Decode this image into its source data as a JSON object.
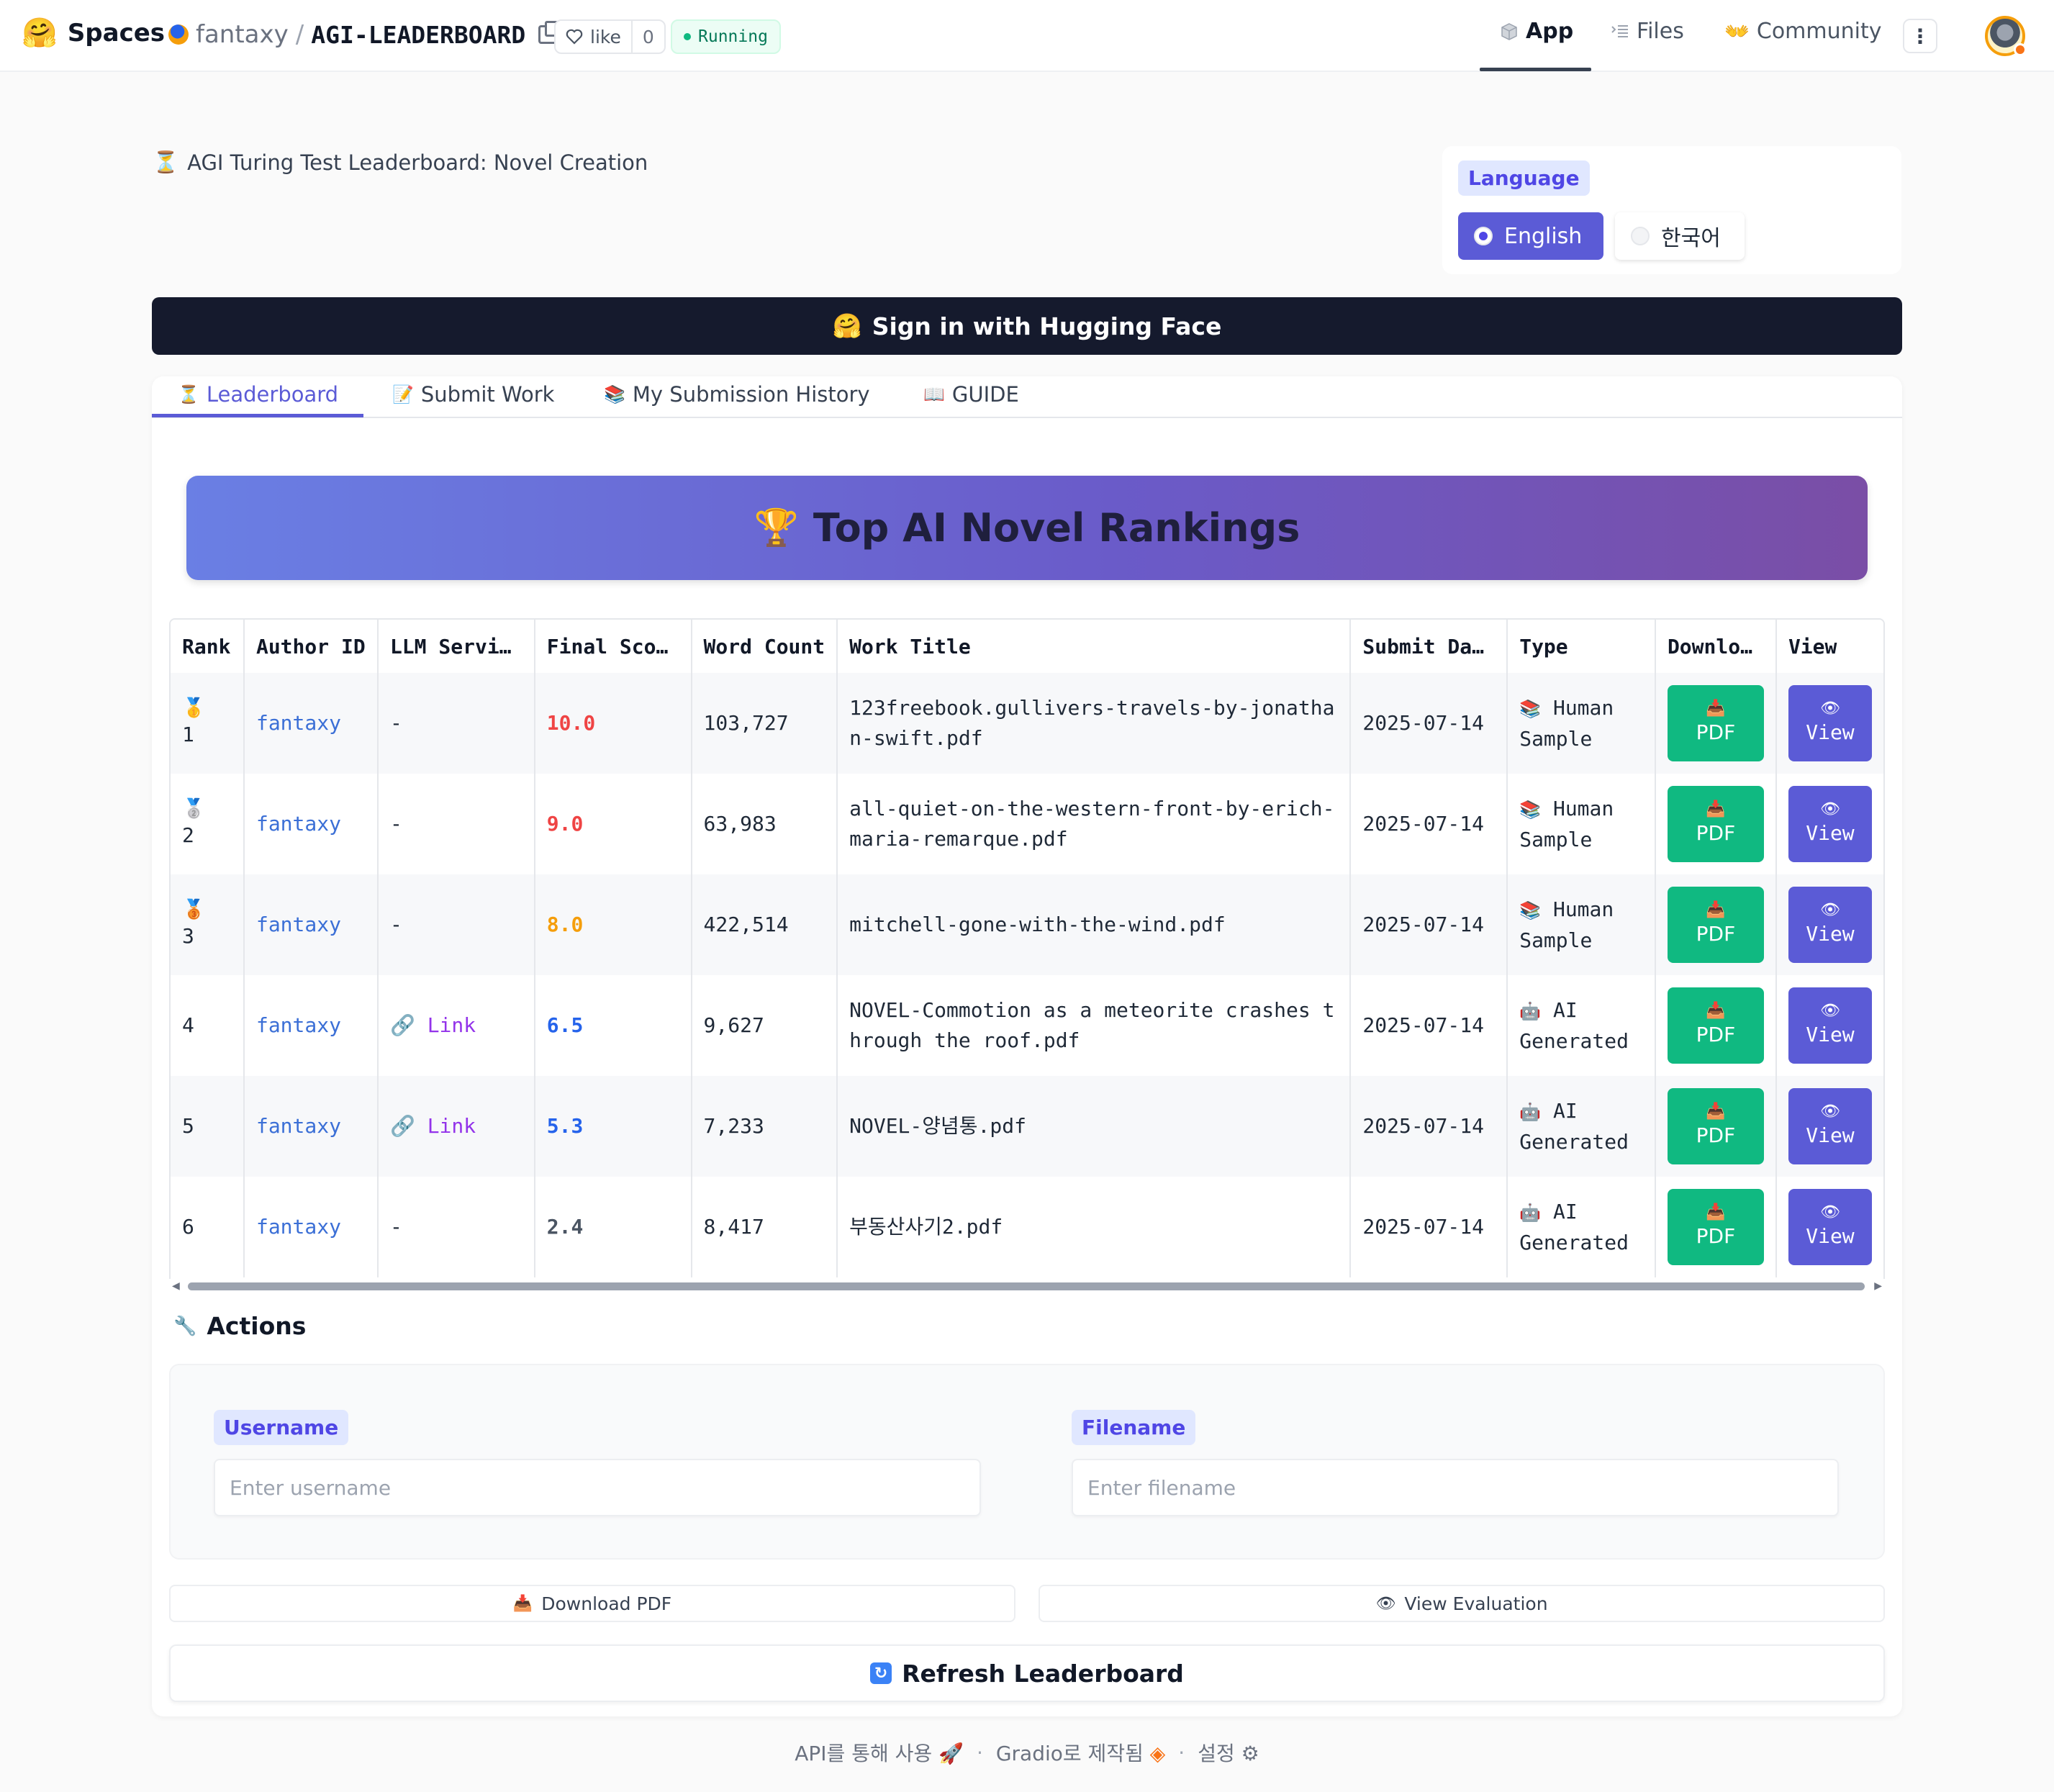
{
  "header": {
    "logo_text": "Spaces",
    "owner": "fantaxy",
    "separator": "/",
    "repo": "AGI-LEADERBOARD",
    "like_label": "like",
    "like_count": "0",
    "status": "Running",
    "nav": {
      "app": "App",
      "files": "Files",
      "community": "Community"
    },
    "kebab": "⋮"
  },
  "app": {
    "title": "AGI Turing Test Leaderboard: Novel Creation",
    "language": {
      "label": "Language",
      "options": [
        "English",
        "한국어"
      ],
      "selected": "English"
    },
    "signin_label": "Sign in with Hugging Face",
    "tabs": [
      "Leaderboard",
      "Submit Work",
      "My Submission History",
      "GUIDE"
    ],
    "active_tab": "Leaderboard",
    "banner_title": "Top AI Novel Rankings",
    "table": {
      "headers": [
        "Rank",
        "Author ID",
        "LLM Servi…",
        "Final Sco…",
        "Word Count",
        "Work Title",
        "Submit Da…",
        "Type",
        "Downlo…",
        "View"
      ],
      "rows": [
        {
          "rank": "1",
          "medal": "🥇",
          "author": "fantaxy",
          "llm": "-",
          "score": "10.0",
          "score_color": "#ef4444",
          "words": "103,727",
          "title": "123freebook.gullivers-travels-by-jonathan-swift.pdf",
          "date": "2025-07-14",
          "type_icon": "📚",
          "type_a": "Human",
          "type_b": "Sample"
        },
        {
          "rank": "2",
          "medal": "🥈",
          "author": "fantaxy",
          "llm": "-",
          "score": "9.0",
          "score_color": "#ef4444",
          "words": "63,983",
          "title": "all-quiet-on-the-western-front-by-erich-maria-remarque.pdf",
          "date": "2025-07-14",
          "type_icon": "📚",
          "type_a": "Human",
          "type_b": "Sample"
        },
        {
          "rank": "3",
          "medal": "🥉",
          "author": "fantaxy",
          "llm": "-",
          "score": "8.0",
          "score_color": "#f59e0b",
          "words": "422,514",
          "title": "mitchell-gone-with-the-wind.pdf",
          "date": "2025-07-14",
          "type_icon": "📚",
          "type_a": "Human",
          "type_b": "Sample"
        },
        {
          "rank": "4",
          "medal": "",
          "author": "fantaxy",
          "llm": "Link",
          "score": "6.5",
          "score_color": "#2563eb",
          "words": "9,627",
          "title": "NOVEL-Commotion as a meteorite crashes through the roof.pdf",
          "date": "2025-07-14",
          "type_icon": "🤖",
          "type_a": "AI",
          "type_b": "Generated"
        },
        {
          "rank": "5",
          "medal": "",
          "author": "fantaxy",
          "llm": "Link",
          "score": "5.3",
          "score_color": "#2563eb",
          "words": "7,233",
          "title": "NOVEL-양념통.pdf",
          "date": "2025-07-14",
          "type_icon": "🤖",
          "type_a": "AI",
          "type_b": "Generated"
        },
        {
          "rank": "6",
          "medal": "",
          "author": "fantaxy",
          "llm": "-",
          "score": "2.4",
          "score_color": "#4b5563",
          "words": "8,417",
          "title": "부동산사기2.pdf",
          "date": "2025-07-14",
          "type_icon": "🤖",
          "type_a": "AI",
          "type_b": "Generated"
        }
      ],
      "pdf_label": "PDF",
      "view_label": "View"
    },
    "actions": {
      "title": "Actions",
      "username_label": "Username",
      "username_placeholder": "Enter username",
      "filename_label": "Filename",
      "filename_placeholder": "Enter filename",
      "download_label": "Download PDF",
      "view_eval_label": "View Evaluation",
      "refresh_label": "Refresh Leaderboard"
    }
  },
  "footer": {
    "api": "API를 통해 사용",
    "built": "Gradio로 제작됨",
    "settings": "설정",
    "dot": "·"
  }
}
